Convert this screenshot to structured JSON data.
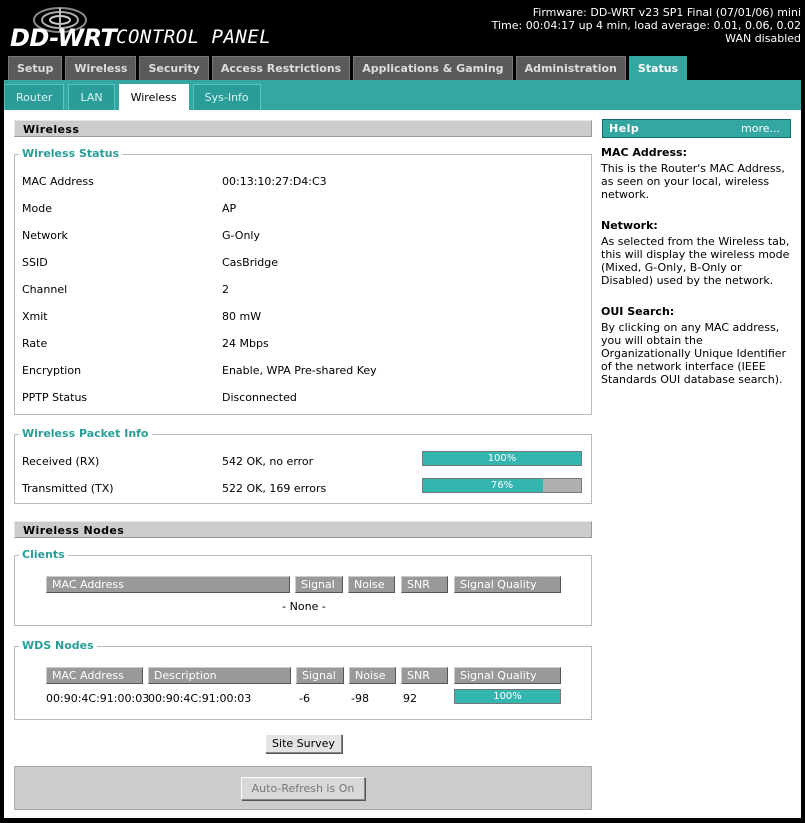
{
  "header": {
    "logo_main": "DD-WRT",
    "logo_sub": "CONTROL PANEL",
    "firmware": "Firmware: DD-WRT v23 SP1 Final (07/01/06) mini",
    "time": "Time: 00:04:17 up 4 min, load average: 0.01, 0.06, 0.02",
    "wan": "WAN disabled"
  },
  "main_tabs": [
    "Setup",
    "Wireless",
    "Security",
    "Access Restrictions",
    "Applications & Gaming",
    "Administration",
    "Status"
  ],
  "sub_tabs": [
    "Router",
    "LAN",
    "Wireless",
    "Sys-Info"
  ],
  "section_wireless": "Wireless",
  "wireless_status": {
    "legend": "Wireless Status",
    "rows": [
      {
        "label": "MAC Address",
        "value": "00:13:10:27:D4:C3"
      },
      {
        "label": "Mode",
        "value": "AP"
      },
      {
        "label": "Network",
        "value": "G-Only"
      },
      {
        "label": "SSID",
        "value": "CasBridge"
      },
      {
        "label": "Channel",
        "value": "2"
      },
      {
        "label": "Xmit",
        "value": "80 mW"
      },
      {
        "label": "Rate",
        "value": "24 Mbps"
      },
      {
        "label": "Encryption",
        "value": "Enable, WPA Pre-shared Key"
      },
      {
        "label": "PPTP Status",
        "value": "Disconnected"
      }
    ]
  },
  "packet_info": {
    "legend": "Wireless Packet Info",
    "rows": [
      {
        "label": "Received (RX)",
        "value": "542 OK, no error",
        "percent_label": "100%",
        "fraction": 1.0
      },
      {
        "label": "Transmitted (TX)",
        "value": "522 OK, 169 errors",
        "percent_label": "76%",
        "fraction": 0.76
      }
    ]
  },
  "section_nodes": "Wireless Nodes",
  "clients": {
    "legend": "Clients",
    "headers": [
      "MAC Address",
      "Signal",
      "Noise",
      "SNR",
      "Signal Quality"
    ],
    "empty": "- None -"
  },
  "wds": {
    "legend": "WDS Nodes",
    "headers": [
      "MAC Address",
      "Description",
      "Signal",
      "Noise",
      "SNR",
      "Signal Quality"
    ],
    "row": {
      "mac": "00:90:4C:91:00:03",
      "description": "00:90:4C:91:00:03",
      "signal": "-6",
      "noise": "-98",
      "snr": "92",
      "quality_label": "100%",
      "quality_fraction": 1.0
    }
  },
  "buttons": {
    "site_survey": "Site Survey",
    "auto_refresh": "Auto-Refresh is On"
  },
  "help": {
    "title": "Help",
    "more": "more...",
    "items": [
      {
        "heading": "MAC Address:",
        "text": "This is the Router's MAC Address, as seen on your local, wireless network."
      },
      {
        "heading": "Network:",
        "text": "As selected from the Wireless tab, this will display the wireless mode (Mixed, G-Only, B-Only or Disabled) used by the network."
      },
      {
        "heading": "OUI Search:",
        "text": "By clicking on any MAC address, you will obtain the Organizationally Unique Identifier of the network interface (IEEE Standards OUI database search)."
      }
    ]
  },
  "colors": {
    "accent": "#34a7a2",
    "bar_fill": "#34b6b0",
    "legend": "#2a9d98"
  }
}
